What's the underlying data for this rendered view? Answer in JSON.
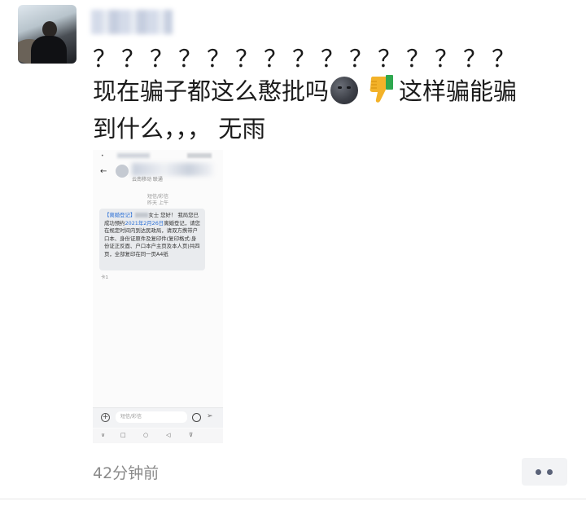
{
  "post": {
    "line1": "？？？？？？？？？？？？？？？",
    "line2a": "现在骗子都这么憨批吗",
    "line2b": "这样骗能骗",
    "line3": "到什么，，，  无雨",
    "time": "42分钟前",
    "emoji": [
      "new-moon-face",
      "thumbs-down"
    ]
  },
  "screenshot": {
    "contact_sub": "云南移动 联通",
    "timestamps": [
      "短信/彩信",
      "昨天 上午"
    ],
    "message_parts": [
      "【离婚登记】",
      "女士 您好！",
      "我局您已成功预约",
      "2021年2月26日",
      "离婚登记，请您在规定时间内到达民政局，请双方携带户口本、身份证原件及复印件(复印格式:身份证正反面、户口本户主页及本人页)共四页，全部复印在同一页A4纸"
    ],
    "sim": "卡1",
    "input_placeholder": "短信/彩信",
    "nav_icons": [
      "∨",
      "□",
      "○",
      "◁",
      "⊽"
    ]
  },
  "colors": {
    "link": "#2a6fd6",
    "more_dot": "#5a6278",
    "time_text": "#8a8a8a"
  }
}
